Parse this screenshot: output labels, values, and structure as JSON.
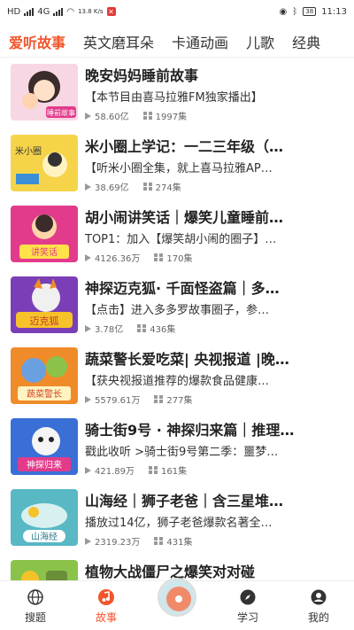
{
  "status_bar": {
    "net_left": "HD",
    "net_type1": "4G",
    "net_type2": "4G",
    "speed": "13.8 K/s",
    "battery": "38",
    "time": "11:13"
  },
  "tabs": [
    {
      "label": "爱听故事",
      "active": true
    },
    {
      "label": "英文磨耳朵",
      "active": false
    },
    {
      "label": "卡通动画",
      "active": false
    },
    {
      "label": "儿歌",
      "active": false
    },
    {
      "label": "经典",
      "active": false
    }
  ],
  "items": [
    {
      "title": "晚安妈妈睡前故事",
      "desc": "【本节目由喜马拉雅FM独家播出】",
      "plays": "58.60亿",
      "tracks": "1997集",
      "thumb_label": "睡前故事",
      "thumb_color": "#f7d7e3"
    },
    {
      "title": "米小圈上学记：一二三年级（…",
      "desc": "【听米小圈全集，就上喜马拉雅AP…",
      "plays": "38.69亿",
      "tracks": "274集",
      "thumb_label": "米小圈",
      "thumb_color": "#f6d44a"
    },
    {
      "title": "胡小闹讲笑话｜爆笑儿童睡前…",
      "desc": "TOP1：加入【爆笑胡小闹的圈子】…",
      "plays": "4126.36万",
      "tracks": "170集",
      "thumb_label": "讲笑话",
      "thumb_color": "#e23b8c"
    },
    {
      "title": "神探迈克狐· 千面怪盗篇｜多…",
      "desc": "【点击】进入多多罗故事圈子，参…",
      "plays": "3.78亿",
      "tracks": "436集",
      "thumb_label": "迈克狐",
      "thumb_color": "#7a3fb6"
    },
    {
      "title": "蔬菜警长爱吃菜| 央视报道 |晚…",
      "desc": "【获央视报道推荐的爆款食品健康…",
      "plays": "5579.61万",
      "tracks": "277集",
      "thumb_label": "蔬菜警长",
      "thumb_color": "#f08b2a"
    },
    {
      "title": "骑士街9号 · 神探归来篇｜推理…",
      "desc": "戳此收听 >骑士街9号第二季：噩梦…",
      "plays": "421.89万",
      "tracks": "161集",
      "thumb_label": "神探归来",
      "thumb_color": "#3a6fd6"
    },
    {
      "title": "山海经｜狮子老爸｜含三星堆…",
      "desc": "播放过14亿，狮子老爸爆款名著全…",
      "plays": "2319.23万",
      "tracks": "431集",
      "thumb_label": "山海经",
      "thumb_color": "#58b8c4"
    },
    {
      "title": "植物大战僵尸之爆笑对对碰",
      "desc": "",
      "plays": "",
      "tracks": "",
      "thumb_label": "",
      "thumb_color": "#8bc34a"
    }
  ],
  "nav": {
    "search": "搜题",
    "story": "故事",
    "study": "学习",
    "mine": "我的"
  },
  "colors": {
    "accent": "#f2552c"
  }
}
